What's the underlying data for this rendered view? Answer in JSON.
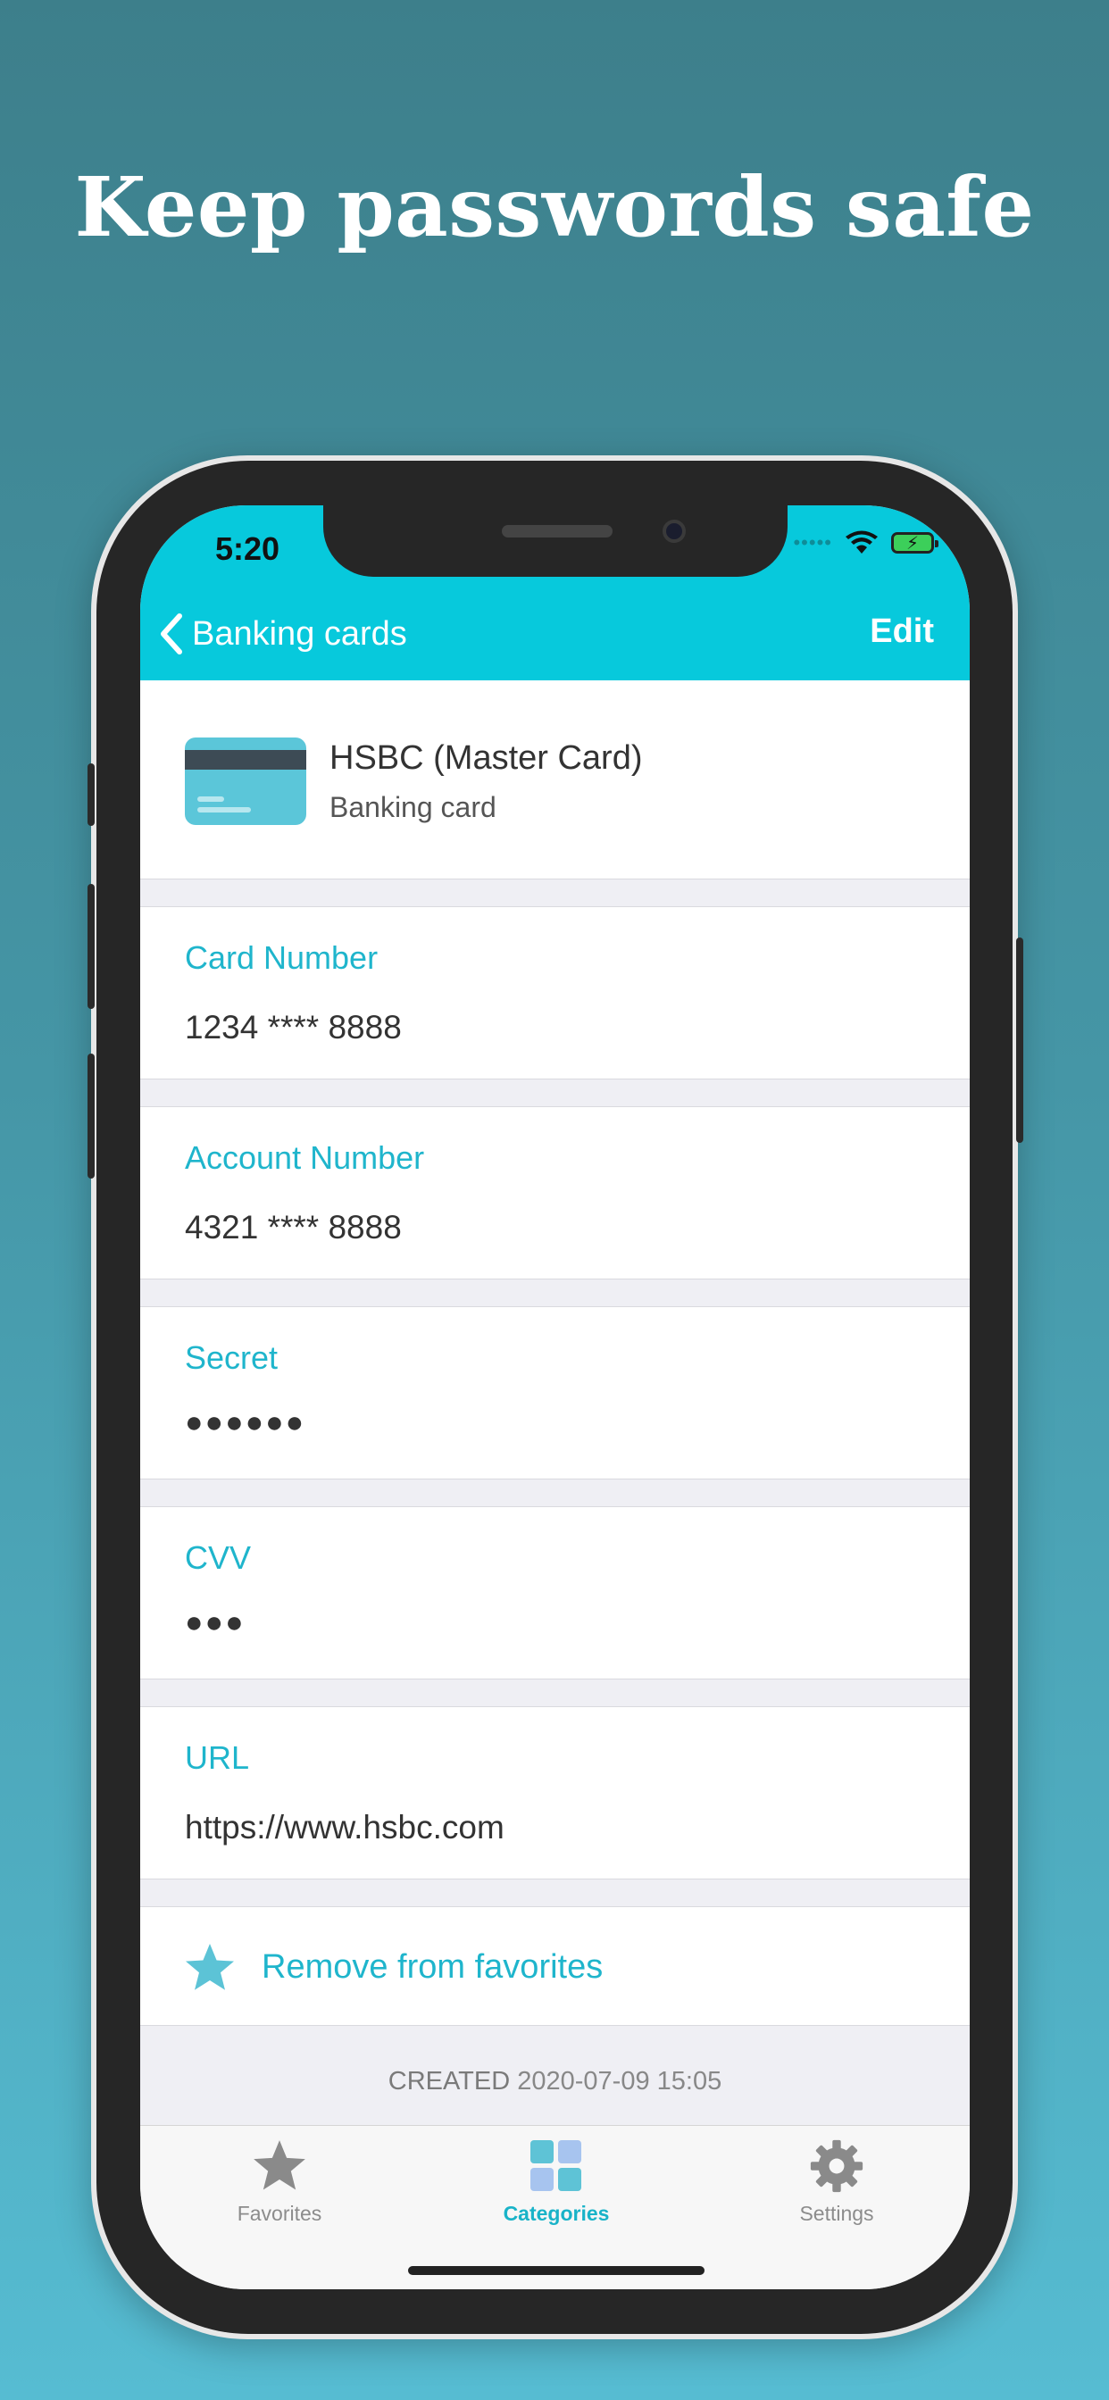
{
  "headline": "Keep passwords safe",
  "status": {
    "time": "5:20",
    "signal_dots": "•••••"
  },
  "nav": {
    "back_label": "Banking cards",
    "edit_label": "Edit"
  },
  "item": {
    "title": "HSBC (Master Card)",
    "subtitle": "Banking card"
  },
  "fields": [
    {
      "label": "Card Number",
      "value": "1234 **** 8888"
    },
    {
      "label": "Account Number",
      "value": "4321 **** 8888"
    },
    {
      "label": "Secret",
      "value": "●●●●●●"
    },
    {
      "label": "CVV",
      "value": "●●●"
    },
    {
      "label": "URL",
      "value": "https://www.hsbc.com"
    }
  ],
  "favorite_action": "Remove from favorites",
  "created": {
    "label": "CREATED",
    "value": "2020-07-09 15:05"
  },
  "tabs": [
    {
      "label": "Favorites",
      "icon": "star-icon"
    },
    {
      "label": "Categories",
      "icon": "grid-icon",
      "active": true
    },
    {
      "label": "Settings",
      "icon": "gear-icon"
    }
  ],
  "colors": {
    "accent": "#07c9dc",
    "label": "#1fb5cc"
  }
}
